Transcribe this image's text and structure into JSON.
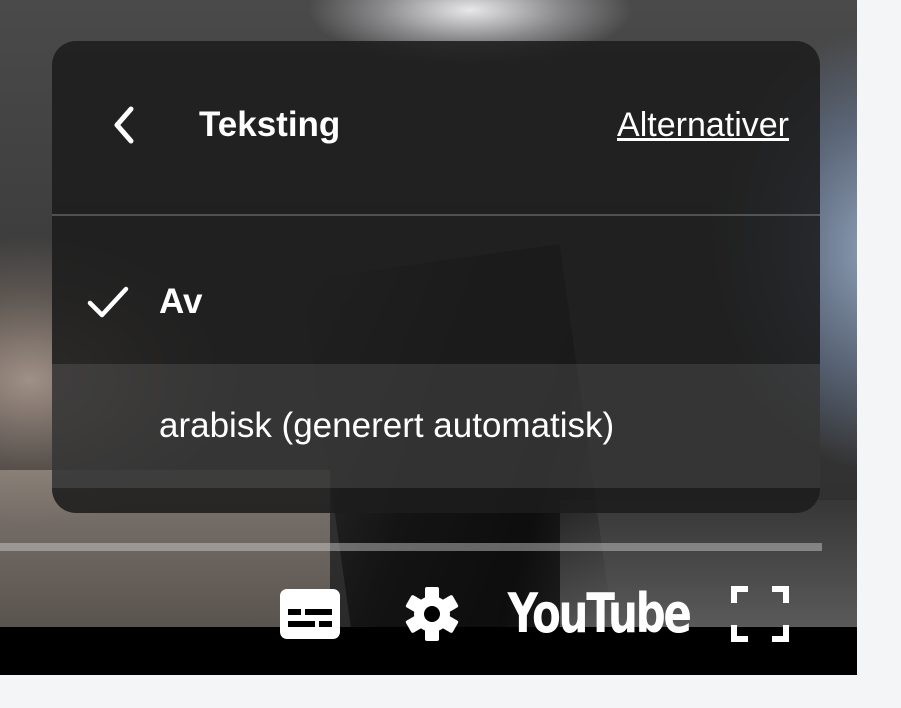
{
  "menu": {
    "title": "Teksting",
    "options_link": "Alternativer",
    "items": [
      {
        "label": "Av",
        "selected": true,
        "icon": "check-icon"
      },
      {
        "label": "arabisk (generert automatisk)",
        "selected": false
      }
    ]
  },
  "controls": {
    "subtitles_icon": "subtitles-icon",
    "settings_icon": "gear-icon",
    "logo_text": "YouTube",
    "fullscreen_icon": "fullscreen-icon"
  },
  "colors": {
    "menu_background": "#1c1c1c",
    "control_bar": "#000000",
    "page_background": "#f4f5f7",
    "text": "#ffffff"
  }
}
